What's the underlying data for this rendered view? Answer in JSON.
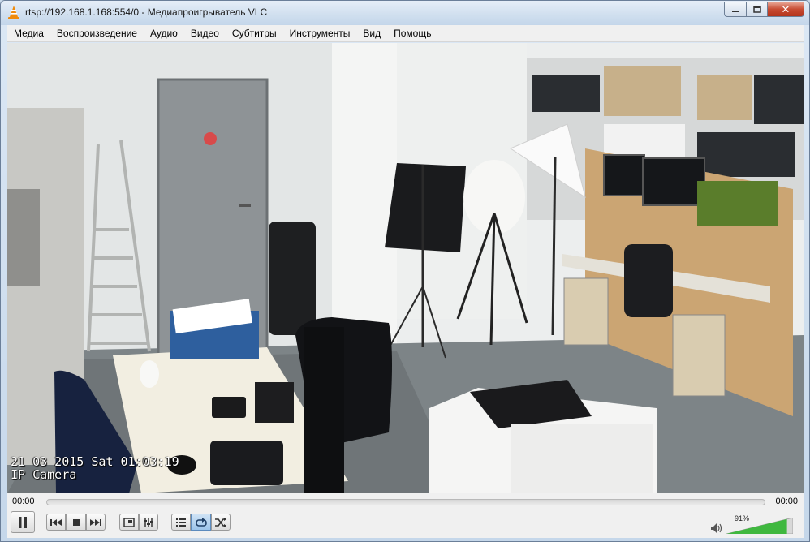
{
  "window": {
    "title": "rtsp://192.168.1.168:554/0 - Медиапроигрыватель VLC",
    "minimize_icon": "minimize-icon",
    "maximize_icon": "maximize-icon",
    "close_icon": "close-icon",
    "close_glyph": "✕"
  },
  "menu": [
    {
      "label": "Медиа"
    },
    {
      "label": "Воспроизведение"
    },
    {
      "label": "Аудио"
    },
    {
      "label": "Видео"
    },
    {
      "label": "Субтитры"
    },
    {
      "label": "Инструменты"
    },
    {
      "label": "Вид"
    },
    {
      "label": "Помощь"
    }
  ],
  "video": {
    "osd_datetime": "21 03 2015 Sat 01:03:19",
    "osd_camera": "IP Camera"
  },
  "player": {
    "time_current": "00:00",
    "time_total": "00:00",
    "progress": 0,
    "volume_label": "91%",
    "volume_fraction": 0.91,
    "accent_color": "#3fb83f",
    "buttons": [
      {
        "name": "pause-button",
        "icon": "pause-icon"
      },
      {
        "name": "previous-button",
        "icon": "previous-icon"
      },
      {
        "name": "stop-button",
        "icon": "stop-icon"
      },
      {
        "name": "next-button",
        "icon": "next-icon"
      },
      {
        "name": "fullscreen-button",
        "icon": "fullscreen-icon"
      },
      {
        "name": "extended-settings-button",
        "icon": "equalizer-icon"
      },
      {
        "name": "playlist-button",
        "icon": "playlist-icon"
      },
      {
        "name": "loop-button",
        "icon": "loop-icon",
        "active": true
      },
      {
        "name": "shuffle-button",
        "icon": "shuffle-icon"
      }
    ]
  }
}
